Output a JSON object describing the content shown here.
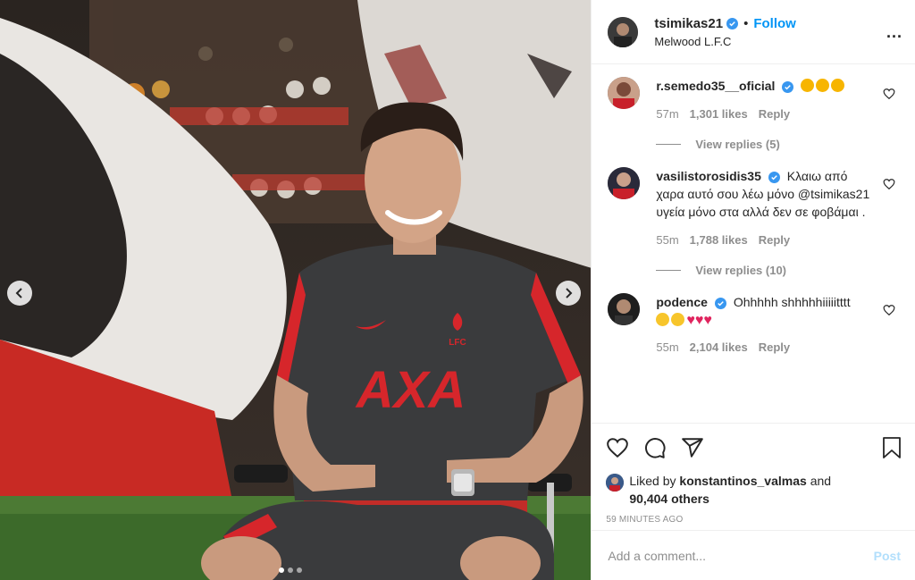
{
  "header": {
    "username": "tsimikas21",
    "follow_label": "Follow",
    "location": "Melwood L.F.C",
    "more_label": "..."
  },
  "media": {
    "carousel_total": 3,
    "carousel_active": 1,
    "shirt_text": "AXA",
    "crest_text": "LFC"
  },
  "comments": [
    {
      "username": "r.semedo35__oficial",
      "text": "",
      "emojis": [
        "star-eyes-emoji",
        "star-eyes-emoji",
        "star-eyes-emoji"
      ],
      "age": "57m",
      "likes": "1,301 likes",
      "reply_label": "Reply",
      "replies": "View replies (5)"
    },
    {
      "username": "vasilistorosidis35",
      "text": "Κλαιω από χαρα αυτό σου λέω μόνο @tsimikas21 υγεία μόνο στα αλλά δεν σε φοβάμαι .",
      "age": "55m",
      "likes": "1,788 likes",
      "reply_label": "Reply",
      "replies": "View replies (10)"
    },
    {
      "username": "podence",
      "text": "Ohhhhh shhhhhiiiiitttt",
      "emojis": [
        "grin-emoji",
        "grin-emoji",
        "red-heart",
        "red-heart",
        "red-heart"
      ],
      "age": "55m",
      "likes": "2,104 likes",
      "reply_label": "Reply"
    }
  ],
  "likes": {
    "prefix": "Liked by",
    "user": "konstantinos_valmas",
    "and": "and",
    "others": "90,404 others"
  },
  "timestamp": "59 MINUTES AGO",
  "add_comment": {
    "placeholder": "Add a comment...",
    "post_label": "Post"
  },
  "colors": {
    "accent": "#0095f6",
    "verified": "#3897f0",
    "heart": "#e0245e",
    "liverpool_red": "#d6262b"
  }
}
